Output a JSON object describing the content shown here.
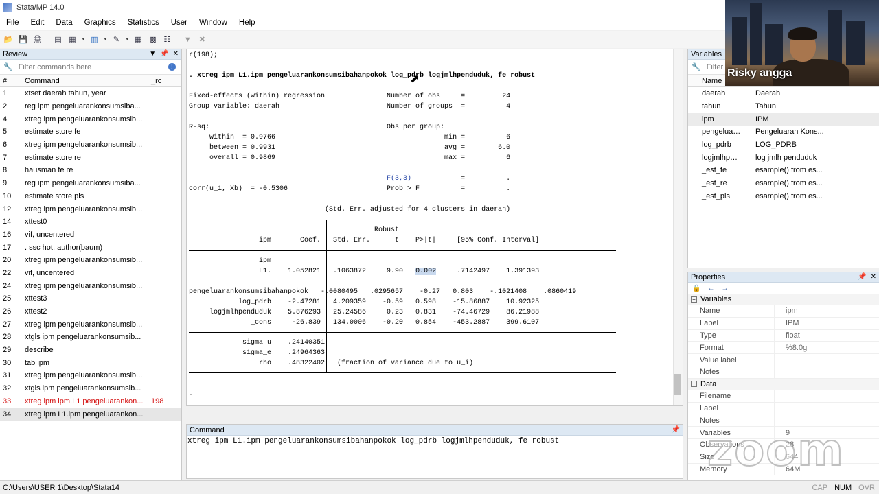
{
  "window": {
    "title": "Stata/MP 14.0"
  },
  "menu": [
    "File",
    "Edit",
    "Data",
    "Graphics",
    "Statistics",
    "User",
    "Window",
    "Help"
  ],
  "review": {
    "title": "Review",
    "filter_placeholder": "Filter commands here",
    "col_num": "#",
    "col_command": "Command",
    "col_rc": "_rc",
    "rows": [
      {
        "num": "1",
        "cmd": "xtset daerah tahun, year",
        "rc": "",
        "err": false
      },
      {
        "num": "2",
        "cmd": "reg ipm pengeluarankonsumsiba...",
        "rc": "",
        "err": false
      },
      {
        "num": "4",
        "cmd": "xtreg ipm pengeluarankonsumsib...",
        "rc": "",
        "err": false
      },
      {
        "num": "5",
        "cmd": "estimate store fe",
        "rc": "",
        "err": false
      },
      {
        "num": "6",
        "cmd": "xtreg ipm pengeluarankonsumsib...",
        "rc": "",
        "err": false
      },
      {
        "num": "7",
        "cmd": "estimate store re",
        "rc": "",
        "err": false
      },
      {
        "num": "8",
        "cmd": "hausman fe re",
        "rc": "",
        "err": false
      },
      {
        "num": "9",
        "cmd": "reg ipm pengeluarankonsumsiba...",
        "rc": "",
        "err": false
      },
      {
        "num": "10",
        "cmd": "estimate store pls",
        "rc": "",
        "err": false
      },
      {
        "num": "12",
        "cmd": "xtreg ipm pengeluarankonsumsib...",
        "rc": "",
        "err": false
      },
      {
        "num": "14",
        "cmd": "xttest0",
        "rc": "",
        "err": false
      },
      {
        "num": "16",
        "cmd": "vif, uncentered",
        "rc": "",
        "err": false
      },
      {
        "num": "17",
        "cmd": ". ssc hot, author(baum)",
        "rc": "",
        "err": false
      },
      {
        "num": "20",
        "cmd": "xtreg ipm pengeluarankonsumsib...",
        "rc": "",
        "err": false
      },
      {
        "num": "22",
        "cmd": "vif, uncentered",
        "rc": "",
        "err": false
      },
      {
        "num": "24",
        "cmd": "xtreg ipm pengeluarankonsumsib...",
        "rc": "",
        "err": false
      },
      {
        "num": "25",
        "cmd": "xttest3",
        "rc": "",
        "err": false
      },
      {
        "num": "26",
        "cmd": "xttest2",
        "rc": "",
        "err": false
      },
      {
        "num": "27",
        "cmd": "xtreg ipm pengeluarankonsumsib...",
        "rc": "",
        "err": false
      },
      {
        "num": "28",
        "cmd": "xtgls ipm pengeluarankonsumsib...",
        "rc": "",
        "err": false
      },
      {
        "num": "29",
        "cmd": "describe",
        "rc": "",
        "err": false
      },
      {
        "num": "30",
        "cmd": "tab ipm",
        "rc": "",
        "err": false
      },
      {
        "num": "31",
        "cmd": "xtreg ipm pengeluarankonsumsib...",
        "rc": "",
        "err": false
      },
      {
        "num": "32",
        "cmd": "xtgls ipm pengeluarankonsumsib...",
        "rc": "",
        "err": false
      },
      {
        "num": "33",
        "cmd": "xtreg ipm ipm.L1 pengeluarankon...",
        "rc": "198",
        "err": true
      },
      {
        "num": "34",
        "cmd": "xtreg ipm L1.ipm pengeluarankon...",
        "rc": "",
        "err": false
      }
    ]
  },
  "results": {
    "lines": {
      "r198": "r(198);",
      "cmdline": ". xtreg ipm L1.ipm pengeluarankonsumsibahanpokok log_pdrb logjmlhpenduduk, fe robust",
      "l1": "Fixed-effects (within) regression               Number of obs     =         24",
      "l2": "Group variable: daerah                          Number of groups  =          4",
      "l3": "R-sq:                                           Obs per group:",
      "l4": "     within  = 0.9766                                         min =          6",
      "l5": "     between = 0.9931                                         avg =        6.0",
      "l6": "     overall = 0.9869                                         max =          6",
      "l7a": "                                                ",
      "l7b": "F(3,3)",
      "l7c": "            =          .",
      "l8": "corr(u_i, Xb)  = -0.5306                        Prob > F          =          .",
      "l9": "                                 (Std. Err. adjusted for 4 clusters in daerah)",
      "h1": "                                             Robust",
      "h2": "                 ipm       Coef.   Std. Err.      t    P>|t|     [95% Conf. Interval]",
      "r1": "                 ipm",
      "r2a": "                 L1.    1.052821   .1063872     9.90   ",
      "r2b": "0.002",
      "r2c": "     .7142497    1.391393",
      "r3": "pengeluarankonsumsibahanpokok   -.0080495   .0295657    -0.27   0.803    -.1021408    .0860419",
      "r4": "            log_pdrb    -2.47281   4.209359    -0.59   0.598    -15.86887    10.92325",
      "r5": "     logjmlhpenduduk    5.876293   25.24586     0.23   0.831    -74.46729    86.21988",
      "r6": "               _cons     -26.839   134.0006    -0.20   0.854    -453.2887    399.6107",
      "s1": "             sigma_u    .24140351",
      "s2": "             sigma_e    .24964363",
      "s3": "                 rho    .48322402   (fraction of variance due to u_i)",
      "dot": "."
    }
  },
  "command": {
    "title": "Command",
    "text": "xtreg ipm L1.ipm pengeluarankonsumsibahanpokok log_pdrb logjmlhpenduduk, fe robust"
  },
  "variables": {
    "title": "Variables",
    "filter_placeholder": "Filter",
    "col_name": "Name",
    "rows": [
      {
        "name": "daerah",
        "label": "Daerah"
      },
      {
        "name": "tahun",
        "label": "Tahun"
      },
      {
        "name": "ipm",
        "label": "IPM"
      },
      {
        "name": "pengeluaran...",
        "label": "Pengeluaran Kons..."
      },
      {
        "name": "log_pdrb",
        "label": "LOG_PDRB"
      },
      {
        "name": "logjmlhpend...",
        "label": "log jmlh penduduk"
      },
      {
        "name": "_est_fe",
        "label": "esample() from es..."
      },
      {
        "name": "_est_re",
        "label": "esample() from es..."
      },
      {
        "name": "_est_pls",
        "label": "esample() from es..."
      }
    ]
  },
  "properties": {
    "title": "Properties",
    "sec_variables": "Variables",
    "var_rows": [
      {
        "key": "Name",
        "val": "ipm"
      },
      {
        "key": "Label",
        "val": "IPM"
      },
      {
        "key": "Type",
        "val": "float"
      },
      {
        "key": "Format",
        "val": "%8.0g"
      },
      {
        "key": "Value label",
        "val": ""
      },
      {
        "key": "Notes",
        "val": ""
      }
    ],
    "sec_data": "Data",
    "data_rows": [
      {
        "key": "Filename",
        "val": ""
      },
      {
        "key": "Label",
        "val": ""
      },
      {
        "key": "Notes",
        "val": ""
      },
      {
        "key": "Variables",
        "val": "9"
      },
      {
        "key": "Observations",
        "val": "28"
      },
      {
        "key": "Size",
        "val": "644"
      },
      {
        "key": "Memory",
        "val": "64M"
      }
    ]
  },
  "status": {
    "path": "C:\\Users\\USER 1\\Desktop\\Stata14",
    "cap": "CAP",
    "num": "NUM",
    "ovr": "OVR"
  },
  "webcam": {
    "name": "Risky angga"
  },
  "watermark": "zoom"
}
